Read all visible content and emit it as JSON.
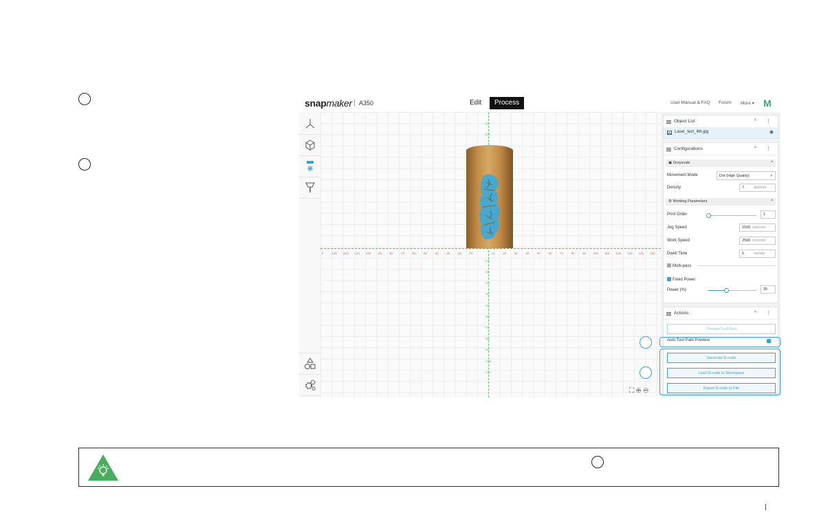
{
  "app": {
    "logo_main": "snap",
    "logo_sub": "maker",
    "machine": "A350",
    "tabs": [
      {
        "label": "Edit"
      },
      {
        "label": "Process"
      }
    ],
    "links": {
      "manual": "User Manual & FAQ",
      "forum": "Forum",
      "more": "More ▾"
    },
    "brand_icon": "M"
  },
  "canvas": {
    "x_ticks": [
      "0",
      "-130",
      "-120",
      "-110",
      "-100",
      "-90",
      "-80",
      "-70",
      "-60",
      "-50",
      "-40",
      "-30",
      "-20",
      "-10",
      "10",
      "20",
      "30",
      "40",
      "50",
      "60",
      "70",
      "80",
      "90",
      "100",
      "110",
      "120",
      "130",
      "140",
      "150"
    ],
    "y_ticks": [
      "110",
      "100",
      "-10",
      "-20",
      "-30",
      "-40",
      "-50",
      "-60",
      "-70",
      "-80",
      "-90",
      "-100",
      "-110"
    ]
  },
  "panel": {
    "object_list": {
      "title": "Object List",
      "item": "Laser_test_4th.jpg"
    },
    "configurations": {
      "title": "Configurations",
      "greyscale": "Greyscale",
      "movement_mode_label": "Movement Mode",
      "movement_mode_value": "Dot (High Quality)",
      "density_label": "Density",
      "density_value": "7",
      "density_unit": "dot/mm",
      "working_params": "Working Parameters",
      "print_order_label": "Print Order",
      "print_order_value": "1",
      "jog_speed_label": "Jog Speed",
      "jog_speed_value": "1500",
      "jog_speed_unit": "mm/min",
      "work_speed_label": "Work Speed",
      "work_speed_value": "2500",
      "work_speed_unit": "mm/min",
      "dwell_time_label": "Dwell Time",
      "dwell_time_value": "5",
      "dwell_time_unit": "ms/dot",
      "multipass_label": "Multi-pass",
      "fixed_power_label": "Fixed Power",
      "power_label": "Power (%)",
      "power_value": "35"
    },
    "actions": {
      "title": "Actions",
      "preview": "Preview Tool Path",
      "auto_preview": "Auto Tool Path Preview",
      "generate": "Generate G-code",
      "load": "Load G-code to Workspace",
      "export": "Export G-code to File"
    }
  },
  "colors": {
    "accent": "#3aa0d8",
    "tip_green": "#49ad5e",
    "x_axis": "#e07070",
    "y_axis": "#6ac87a"
  }
}
